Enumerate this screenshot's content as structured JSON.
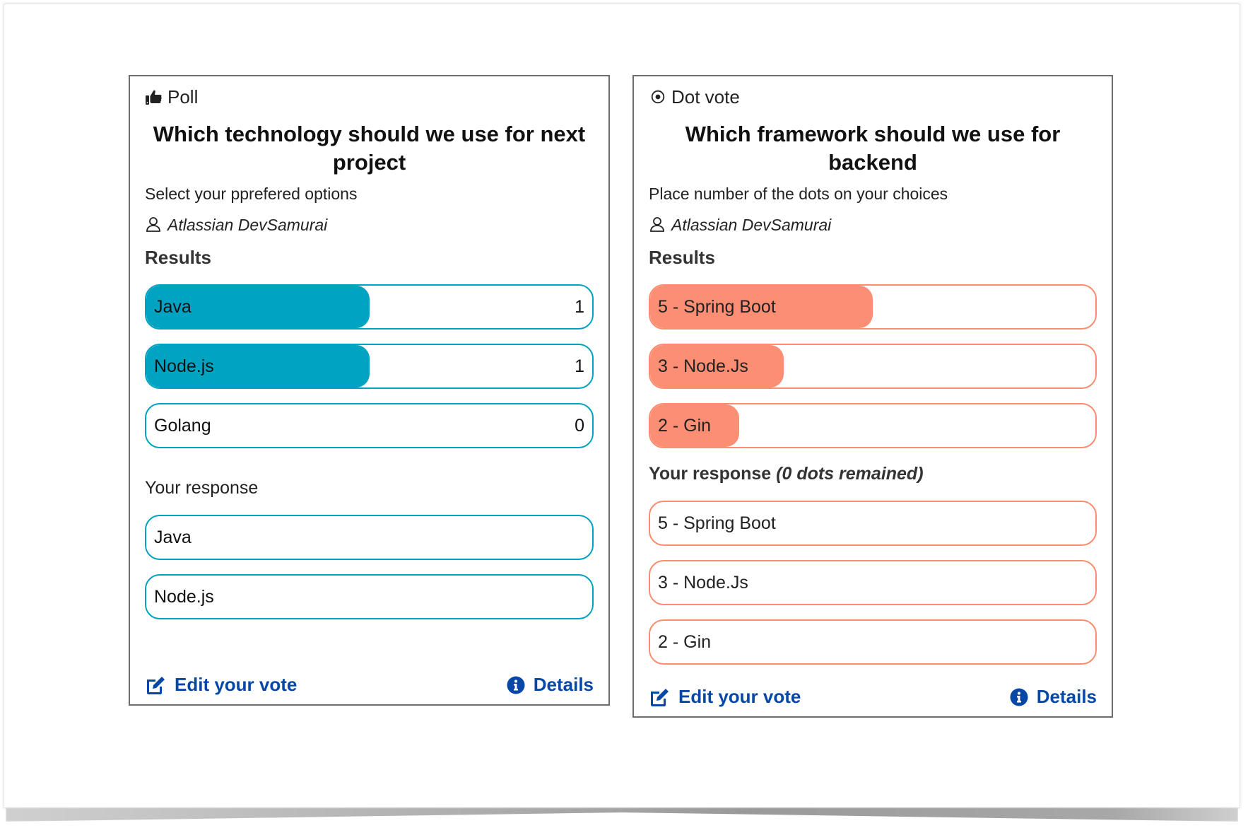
{
  "poll": {
    "type_label": "Poll",
    "type_icon": "thumbs-up-icon",
    "title": "Which technology should we use for next project",
    "description": "Select your pprefered options",
    "author": "Atlassian DevSamurai",
    "results_heading": "Results",
    "accent_color": "#00a3c2",
    "results": [
      {
        "label": "Java",
        "count": "1",
        "fraction": 0.5
      },
      {
        "label": "Node.js",
        "count": "1",
        "fraction": 0.5
      },
      {
        "label": "Golang",
        "count": "0",
        "fraction": 0
      }
    ],
    "response_heading": "Your response",
    "responses": [
      "Java",
      "Node.js"
    ],
    "edit_label": "Edit your vote",
    "details_label": "Details"
  },
  "dot_vote": {
    "type_label": "Dot vote",
    "type_icon": "dot-circle-icon",
    "title": "Which framework should we use for backend",
    "description": "Place number of the dots on your choices",
    "author": "Atlassian DevSamurai",
    "results_heading": "Results",
    "accent_color": "#fc8e73",
    "results": [
      {
        "label": "5 - Spring Boot",
        "fraction": 0.5
      },
      {
        "label": "3 - Node.Js",
        "fraction": 0.3
      },
      {
        "label": "2 - Gin",
        "fraction": 0.2
      }
    ],
    "response_heading": "Your response",
    "response_remaining": "(0 dots remained)",
    "responses": [
      "5 - Spring Boot",
      "3 - Node.Js",
      "2 - Gin"
    ],
    "edit_label": "Edit your vote",
    "details_label": "Details"
  },
  "link_color": "#0747a6"
}
